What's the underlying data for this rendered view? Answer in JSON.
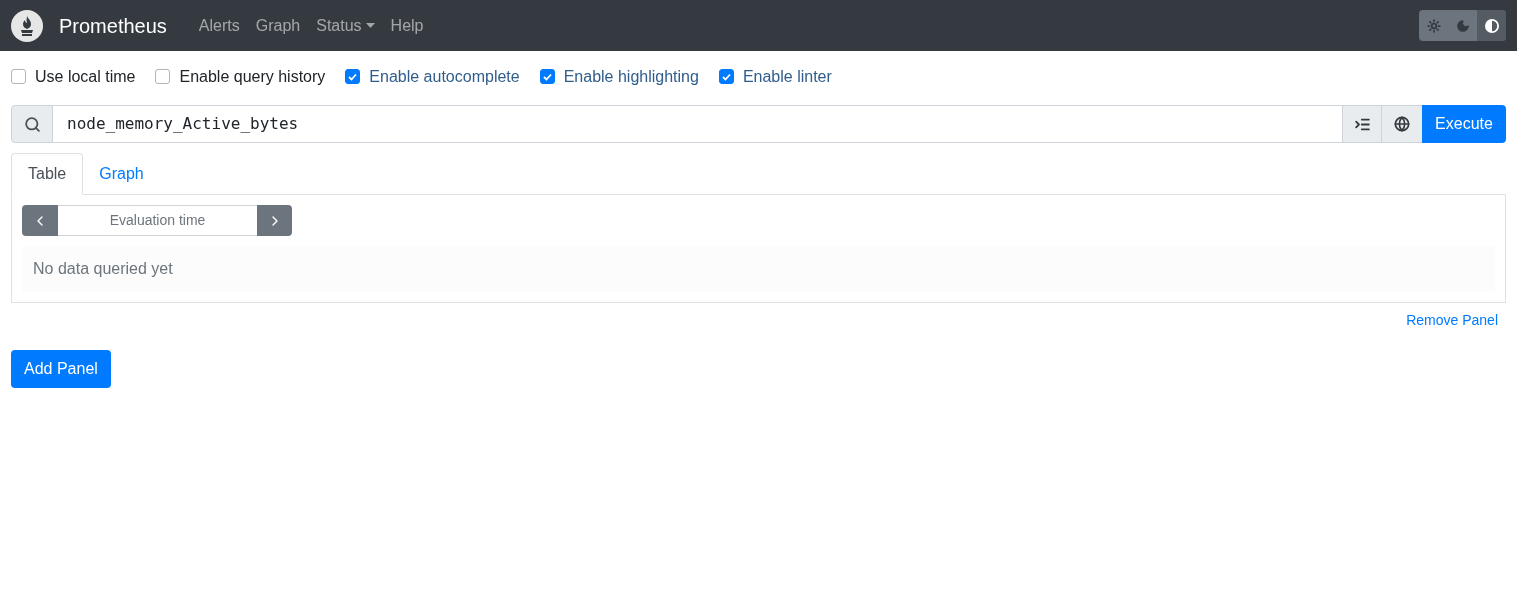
{
  "navbar": {
    "brand": "Prometheus",
    "items": [
      {
        "label": "Alerts",
        "kind": "link"
      },
      {
        "label": "Graph",
        "kind": "link"
      },
      {
        "label": "Status",
        "kind": "dropdown"
      },
      {
        "label": "Help",
        "kind": "link"
      }
    ],
    "theme_buttons": [
      {
        "kind": "light",
        "selected": false
      },
      {
        "kind": "dark",
        "selected": false
      },
      {
        "kind": "auto",
        "selected": true
      }
    ]
  },
  "options": [
    {
      "label": "Use local time",
      "checked": false
    },
    {
      "label": "Enable query history",
      "checked": false
    },
    {
      "label": "Enable autocomplete",
      "checked": true
    },
    {
      "label": "Enable highlighting",
      "checked": true
    },
    {
      "label": "Enable linter",
      "checked": true
    }
  ],
  "query": {
    "value": "node_memory_Active_bytes",
    "execute": "Execute"
  },
  "panel": {
    "tabs": [
      {
        "label": "Table",
        "selected": true
      },
      {
        "label": "Graph",
        "selected": false
      }
    ],
    "evaluation_time": {
      "placeholder": "Evaluation time"
    },
    "message": "No data queried yet",
    "remove": "Remove Panel"
  },
  "add_panel": "Add Panel"
}
